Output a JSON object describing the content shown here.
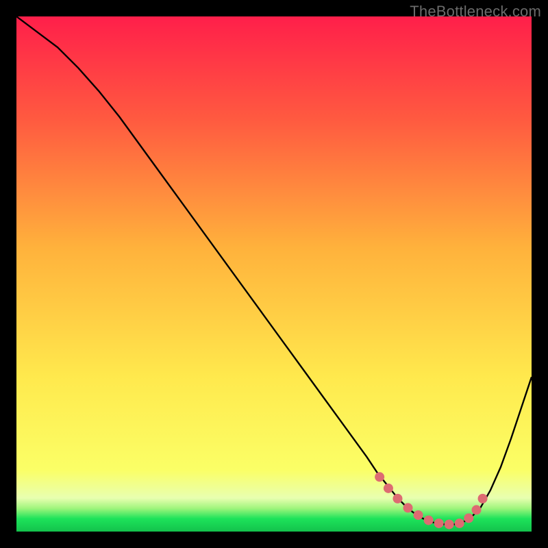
{
  "watermark": {
    "text": "TheBottleneck.com"
  },
  "colors": {
    "bg_black": "#000000",
    "grad_top": "#ff1f4a",
    "grad_mid_upper": "#ff6a3e",
    "grad_mid": "#ffc041",
    "grad_mid_lower": "#ffe94d",
    "grad_low": "#fbff66",
    "grad_green": "#1de35a",
    "curve_stroke": "#000000",
    "marker_fill": "#dd6b72"
  },
  "chart_data": {
    "type": "line",
    "title": "",
    "xlabel": "",
    "ylabel": "",
    "xlim": [
      0,
      100
    ],
    "ylim": [
      0,
      100
    ],
    "curve": {
      "name": "bottleneck-curve",
      "x": [
        0,
        4,
        8,
        12,
        16,
        20,
        24,
        28,
        32,
        36,
        40,
        44,
        48,
        52,
        56,
        60,
        64,
        68,
        70,
        72,
        74,
        76,
        78,
        80,
        82,
        84,
        86,
        88,
        90,
        92,
        94,
        96,
        98,
        100
      ],
      "y": [
        100,
        97,
        94,
        90,
        85.5,
        80.5,
        75,
        69.5,
        64,
        58.5,
        53,
        47.5,
        42,
        36.5,
        31,
        25.5,
        20,
        14.5,
        11.5,
        9,
        6.5,
        4.5,
        3,
        2,
        1.5,
        1.3,
        1.5,
        2.5,
        4.5,
        8,
        12.5,
        18,
        24,
        30
      ]
    },
    "markers": {
      "name": "optimal-range",
      "x": [
        70.5,
        72.2,
        74.0,
        76.0,
        78.0,
        80.0,
        82.0,
        84.0,
        86.0,
        87.8,
        89.3,
        90.5
      ],
      "y": [
        10.6,
        8.4,
        6.4,
        4.6,
        3.2,
        2.2,
        1.6,
        1.4,
        1.6,
        2.6,
        4.2,
        6.4
      ]
    },
    "gradient_heatmap": {
      "description": "vertical red-through-yellow-to-green gradient filling plot area",
      "stops": [
        {
          "offset": 0.0,
          "color": "#ff1f4a"
        },
        {
          "offset": 0.2,
          "color": "#ff5a40"
        },
        {
          "offset": 0.45,
          "color": "#ffb23c"
        },
        {
          "offset": 0.7,
          "color": "#ffe94d"
        },
        {
          "offset": 0.88,
          "color": "#fbff66"
        },
        {
          "offset": 0.935,
          "color": "#e8ffb0"
        },
        {
          "offset": 0.955,
          "color": "#9ff57c"
        },
        {
          "offset": 0.975,
          "color": "#1de35a"
        },
        {
          "offset": 1.0,
          "color": "#13c24c"
        }
      ]
    }
  }
}
